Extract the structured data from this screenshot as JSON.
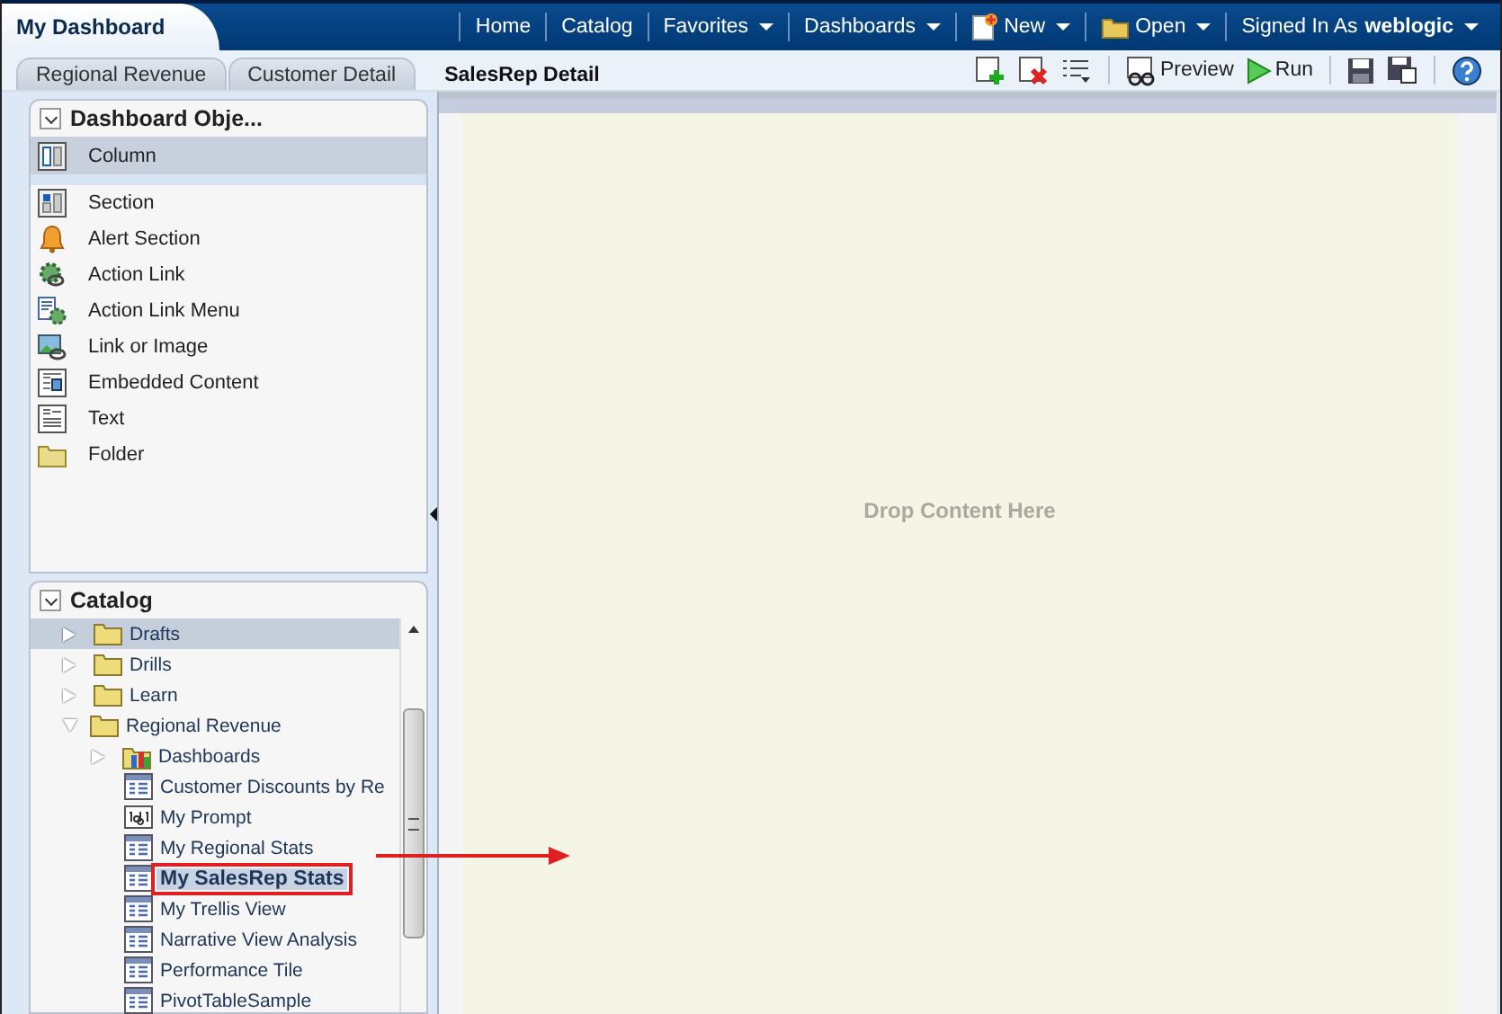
{
  "app_title": "My Dashboard",
  "nav": [
    {
      "label": "Home",
      "kind": "link"
    },
    {
      "label": "Catalog",
      "kind": "link"
    },
    {
      "label": "Favorites",
      "kind": "menu"
    },
    {
      "label": "Dashboards",
      "kind": "menu"
    },
    {
      "label": "New",
      "kind": "new-menu"
    },
    {
      "label": "Open",
      "kind": "open-menu"
    }
  ],
  "user": {
    "prefix": "Signed In As",
    "name": "weblogic"
  },
  "tabs": [
    {
      "label": "Regional Revenue",
      "selected": false
    },
    {
      "label": "Customer Detail",
      "selected": false
    },
    {
      "label": "SalesRep Detail",
      "selected": true
    }
  ],
  "toolbar": [
    {
      "kind": "add-page"
    },
    {
      "kind": "delete-page"
    },
    {
      "kind": "list-menu"
    },
    {
      "kind": "preview",
      "label": "Preview"
    },
    {
      "kind": "run",
      "label": "Run"
    },
    {
      "kind": "save"
    },
    {
      "kind": "save-as"
    },
    {
      "kind": "help"
    }
  ],
  "objects_panel": {
    "title": "Dashboard Obje...",
    "expanded": true,
    "items": [
      {
        "label": "Column",
        "kind": "column",
        "selected": true
      },
      {
        "label": "Section",
        "kind": "section",
        "selected": false
      },
      {
        "label": "Alert Section",
        "kind": "alert",
        "selected": false
      },
      {
        "label": "Action Link",
        "kind": "action-link",
        "selected": false
      },
      {
        "label": "Action Link Menu",
        "kind": "action-menu",
        "selected": false
      },
      {
        "label": "Link or Image",
        "kind": "image-link",
        "selected": false
      },
      {
        "label": "Embedded Content",
        "kind": "embedded",
        "selected": false
      },
      {
        "label": "Text",
        "kind": "text",
        "selected": false
      },
      {
        "label": "Folder",
        "kind": "folder",
        "selected": false
      }
    ]
  },
  "catalog_panel": {
    "title": "Catalog",
    "expanded": true,
    "items": [
      {
        "label": "Drafts",
        "kind": "folder",
        "expanded": false,
        "selected": true,
        "highlighted": false
      },
      {
        "label": "Drills",
        "kind": "folder",
        "expanded": false,
        "selected": false,
        "highlighted": false
      },
      {
        "label": "Learn",
        "kind": "folder",
        "expanded": false,
        "selected": false,
        "highlighted": false
      },
      {
        "label": "Regional Revenue",
        "kind": "folder",
        "expanded": true,
        "selected": false,
        "highlighted": false,
        "children": [
          {
            "label": "Dashboards",
            "kind": "dashboard-folder",
            "expanded": false,
            "selected": false,
            "highlighted": false
          },
          {
            "label": "Customer Discounts by Re",
            "kind": "analysis",
            "selected": false,
            "highlighted": false
          },
          {
            "label": "My Prompt",
            "kind": "prompt",
            "selected": false,
            "highlighted": false
          },
          {
            "label": "My Regional Stats",
            "kind": "analysis",
            "selected": false,
            "highlighted": false
          },
          {
            "label": "My SalesRep Stats",
            "kind": "analysis",
            "selected": false,
            "highlighted": true
          },
          {
            "label": "My Trellis View",
            "kind": "analysis",
            "selected": false,
            "highlighted": false
          },
          {
            "label": "Narrative View Analysis",
            "kind": "analysis",
            "selected": false,
            "highlighted": false
          },
          {
            "label": "Performance Tile",
            "kind": "analysis",
            "selected": false,
            "highlighted": false
          },
          {
            "label": "PivotTableSample",
            "kind": "analysis",
            "selected": false,
            "highlighted": false
          }
        ]
      }
    ]
  },
  "canvas": {
    "placeholder": "Drop Content Here"
  }
}
